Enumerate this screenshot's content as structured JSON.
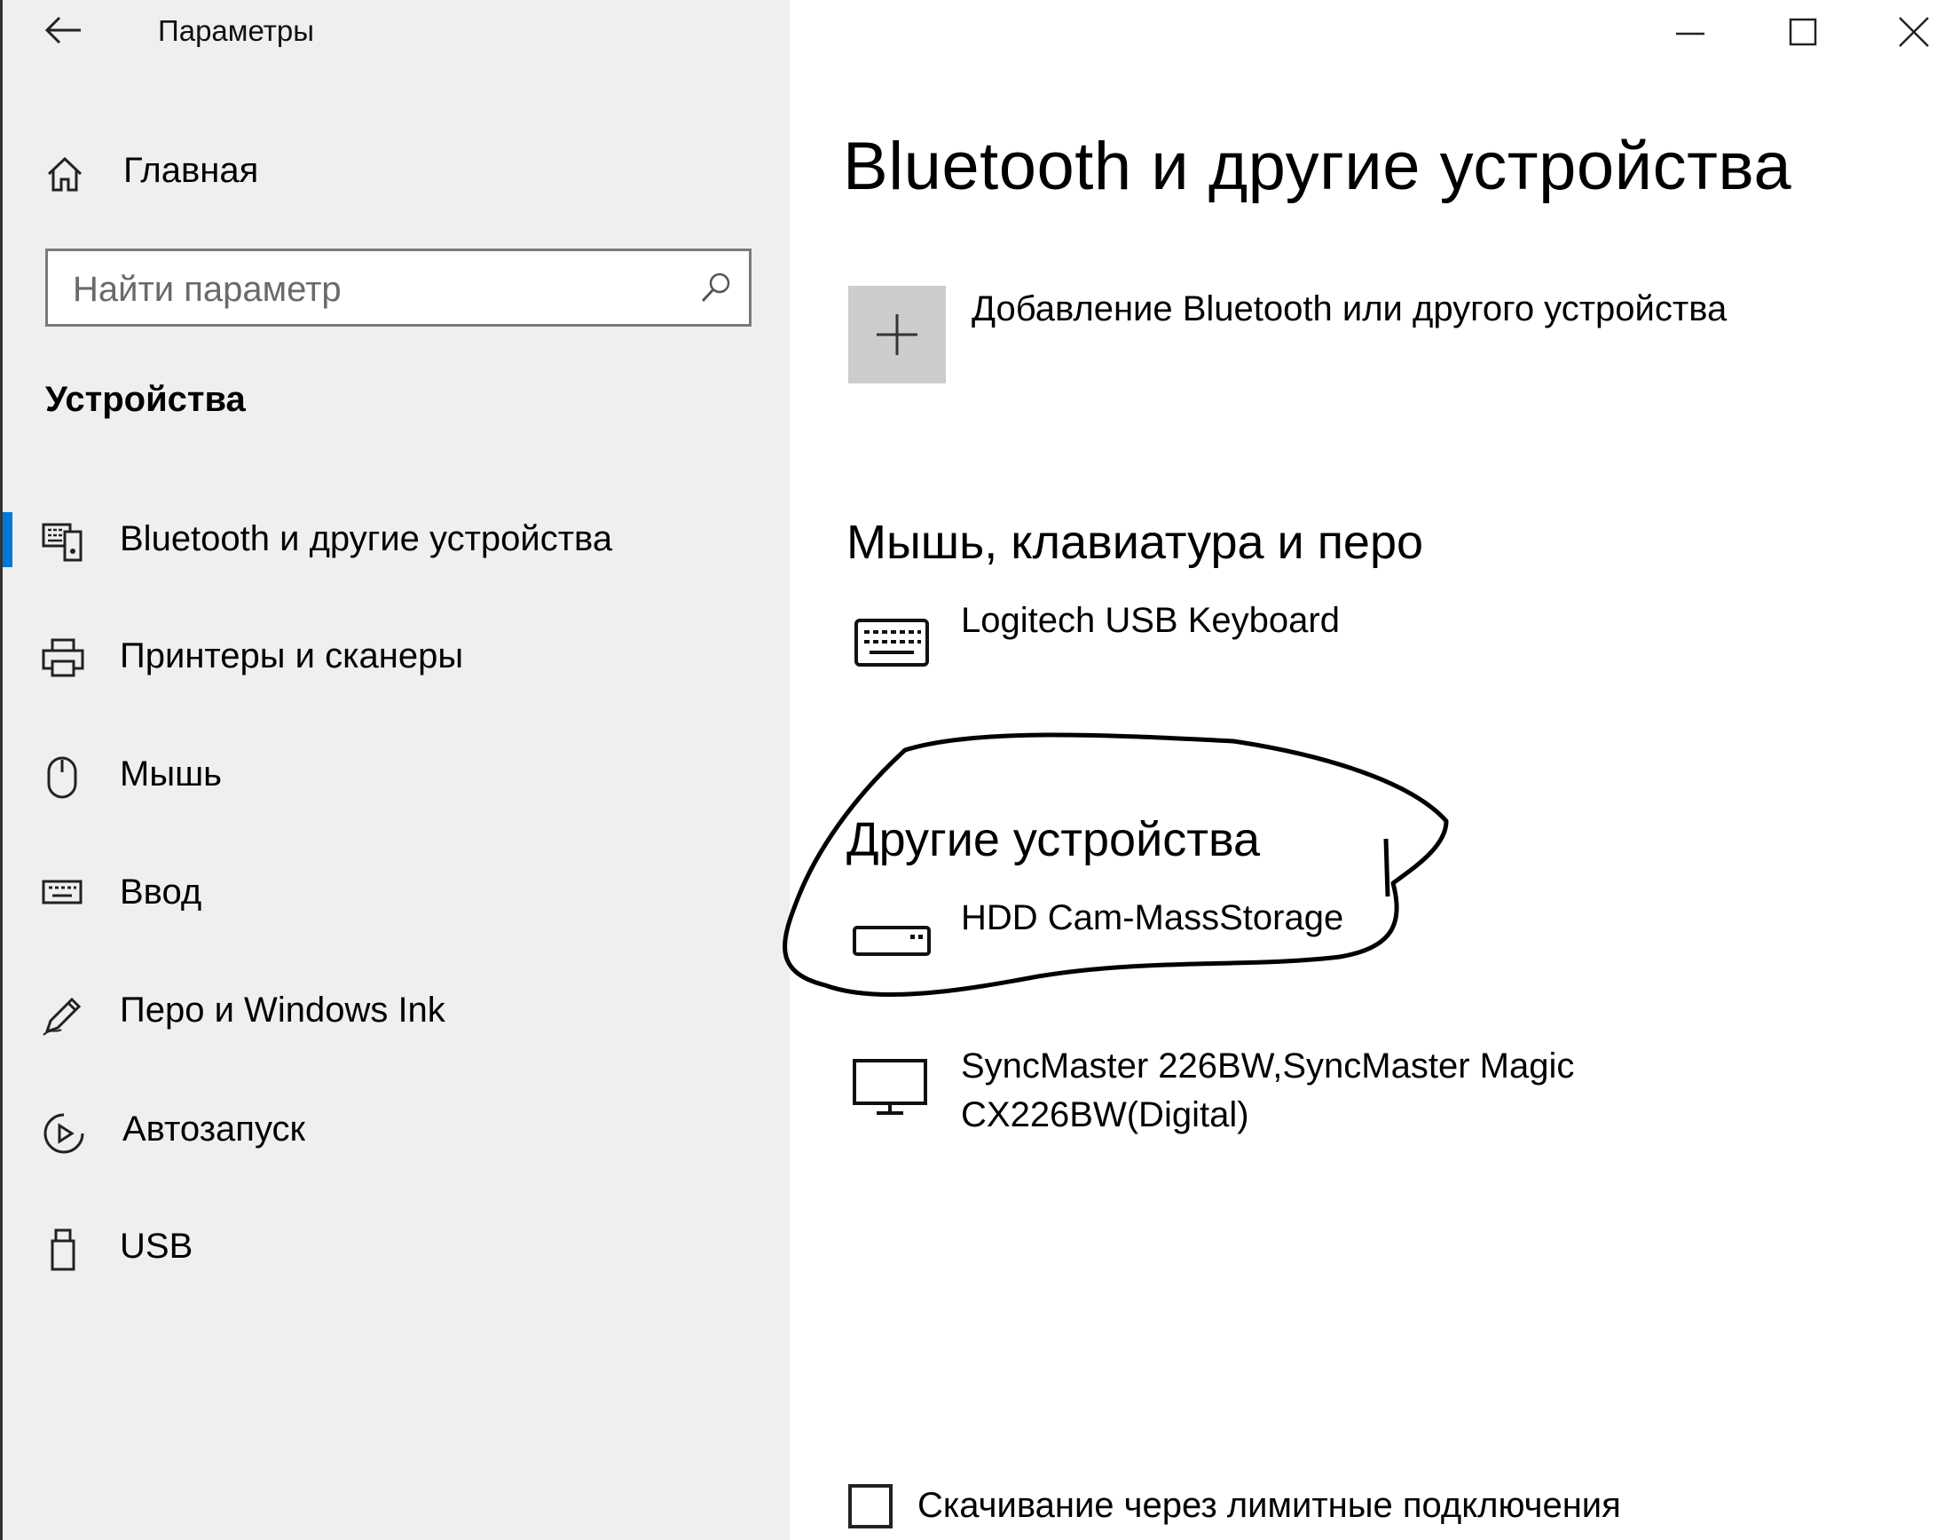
{
  "window": {
    "app_title": "Параметры"
  },
  "sidebar": {
    "home_label": "Главная",
    "search": {
      "placeholder": "Найти параметр"
    },
    "section_title": "Устройства",
    "items": [
      {
        "label": "Bluetooth и другие устройства",
        "icon": "bluetooth-devices-icon",
        "selected": true
      },
      {
        "label": "Принтеры и сканеры",
        "icon": "printer-icon"
      },
      {
        "label": "Мышь",
        "icon": "mouse-icon"
      },
      {
        "label": "Ввод",
        "icon": "keyboard-icon"
      },
      {
        "label": "Перо и Windows Ink",
        "icon": "pen-icon"
      },
      {
        "label": "Автозапуск",
        "icon": "autoplay-icon"
      },
      {
        "label": "USB",
        "icon": "usb-icon"
      }
    ]
  },
  "main": {
    "page_title": "Bluetooth и другие устройства",
    "add_device_label": "Добавление Bluetooth или другого устройства",
    "groups": [
      {
        "title": "Мышь, клавиатура и перо",
        "devices": [
          {
            "name": "Logitech USB Keyboard",
            "icon": "keyboard-device-icon"
          }
        ]
      },
      {
        "title": "Другие устройства",
        "devices": [
          {
            "name": "HDD Cam-MassStorage",
            "icon": "drive-icon"
          },
          {
            "name_line1": "SyncMaster 226BW,SyncMaster Magic",
            "name_line2": "CX226BW(Digital)",
            "icon": "monitor-icon"
          }
        ]
      }
    ],
    "metered_download_label": "Скачивание через лимитные подключения",
    "metered_download_checked": false
  },
  "colors": {
    "accent": "#0078d7",
    "sidebar_bg": "#efefef",
    "add_tile_bg": "#cccccc"
  }
}
